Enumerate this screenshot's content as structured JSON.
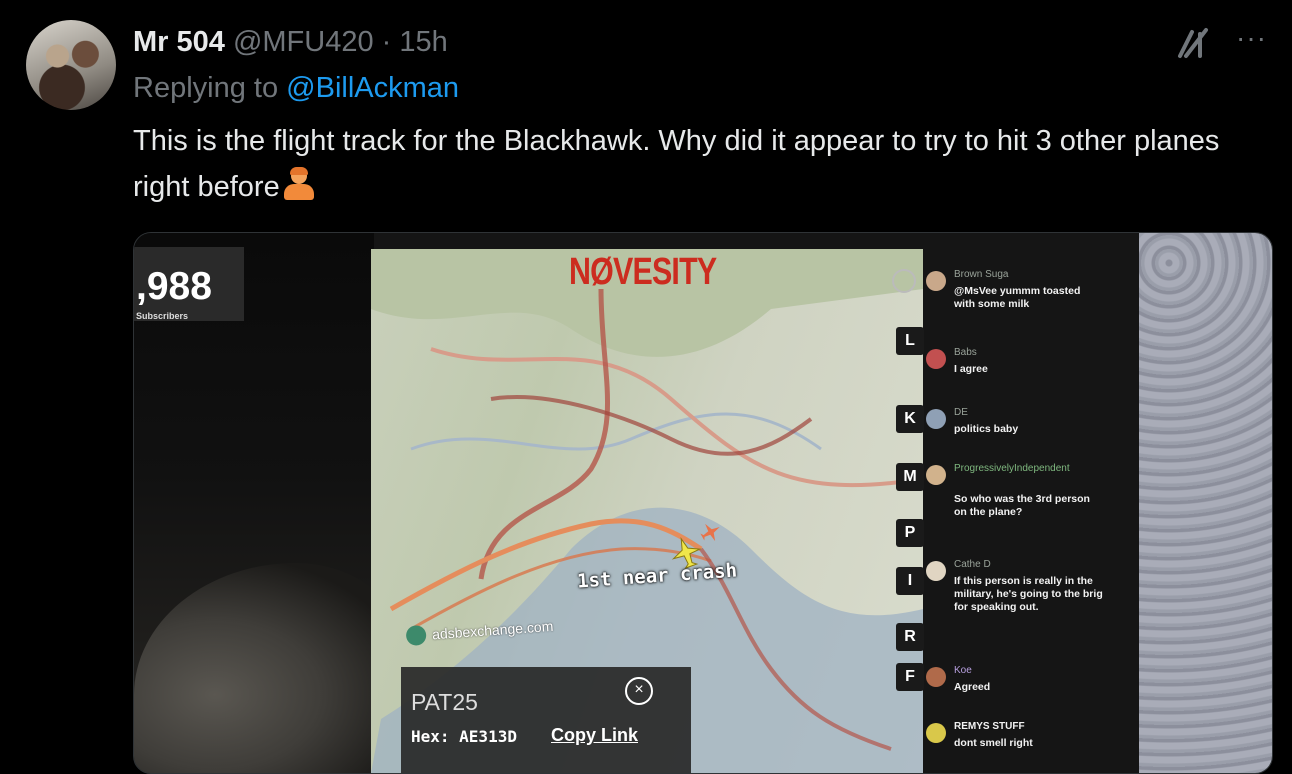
{
  "tweet": {
    "display_name": "Mr 504",
    "handle": "@MFU420",
    "separator": "·",
    "time": "15h",
    "reply_prefix": "Replying to ",
    "reply_handle": "@BillAckman",
    "text": "This is the flight track for the Blackhawk. Why did it appear to try to hit 3 other planes right before",
    "emoji": "person-shrugging",
    "more_label": "···"
  },
  "media": {
    "subscribers_count": ",988",
    "subscribers_label": "Subscribers",
    "map_brand": "NØVESITY",
    "annotation": "1st near crash",
    "source_label": "adsbexchange.com",
    "callsign": "PAT25",
    "hex_line": "Hex: AE313D",
    "copy_link": "Copy Link",
    "sidebar_letters": [
      "L",
      "K",
      "M",
      "P",
      "I",
      "R",
      "F"
    ],
    "chat": [
      {
        "user": "Brown Suga",
        "text": "@MsVee yummm toasted with some milk"
      },
      {
        "user": "Babs",
        "text": "I agree"
      },
      {
        "user": "DE",
        "text": "politics baby"
      },
      {
        "user": "ProgressivelyIndependent",
        "text": "So who was the 3rd person on the plane?"
      },
      {
        "user": "Cathe D",
        "text": "If this person is really in the military, he's going to the brig for speaking out."
      },
      {
        "user": "Koe",
        "text": "Agreed"
      },
      {
        "user": "REMYS STUFF",
        "text": "dont smell right"
      }
    ]
  },
  "colors": {
    "background": "#000000",
    "link": "#1d9bf0",
    "secondary_text": "#71767b",
    "brand_red": "#cc2c1f"
  }
}
